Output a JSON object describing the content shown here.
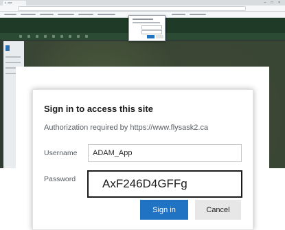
{
  "browser": {
    "tab_title": "A - ADA"
  },
  "dialog": {
    "title": "Sign in to access this site",
    "subtitle": "Authorization required by https://www.flysask2.ca",
    "username_label": "Username",
    "username_value": "ADAM_App",
    "password_label": "Password",
    "password_value": "AxF246D4GFFg",
    "signin_label": "Sign in",
    "cancel_label": "Cancel"
  },
  "colors": {
    "primary_button": "#1f73c2",
    "cancel_button": "#e7e7e7"
  }
}
